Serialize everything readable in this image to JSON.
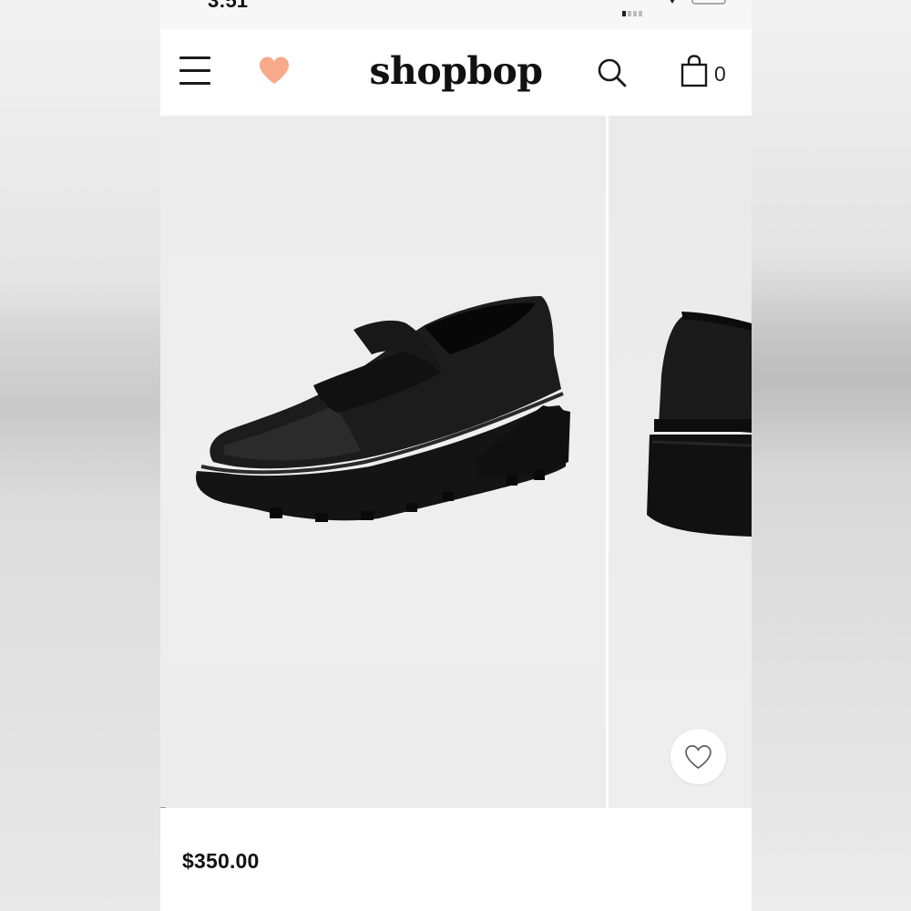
{
  "status_bar": {
    "time": "3:51"
  },
  "header": {
    "logo": "shopbop",
    "bag_count": "0",
    "icons": {
      "menu": "hamburger-menu-icon",
      "wishlist": "heart-icon",
      "search": "search-icon",
      "bag": "shopping-bag-icon"
    },
    "colors": {
      "heart": "#f7a98a",
      "text": "#111111"
    }
  },
  "gallery": {
    "images": [
      "black leather loafer with lug sole, three-quarter front view",
      "black leather loafer heel, partial rear view"
    ],
    "wishlist_icon": "heart-outline-icon"
  },
  "product": {
    "price": "$350.00"
  }
}
